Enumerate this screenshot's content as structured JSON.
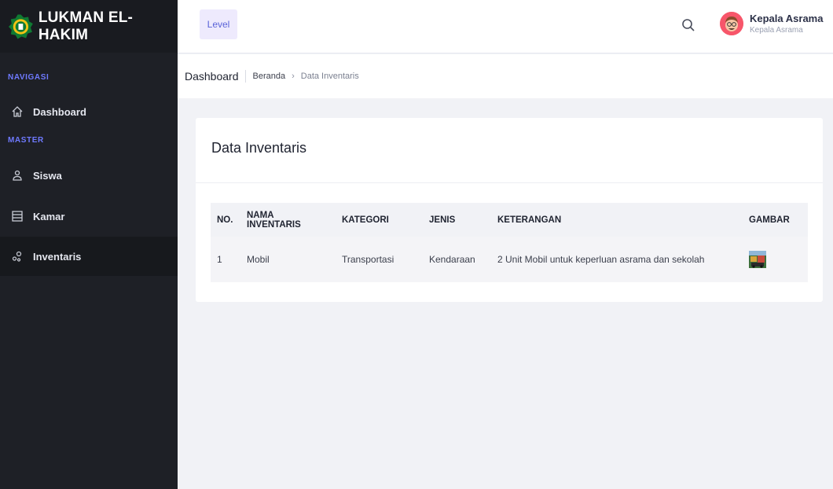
{
  "app": {
    "brand": "LUKMAN EL-HAKIM",
    "logo_icon": "ministry-logo-icon"
  },
  "sidebar": {
    "sections": [
      {
        "label": "NAVIGASI"
      },
      {
        "label": "MASTER"
      }
    ],
    "items": [
      {
        "label": "Dashboard",
        "icon": "home-icon",
        "active": false
      },
      {
        "label": "Siswa",
        "icon": "user-icon",
        "active": false
      },
      {
        "label": "Kamar",
        "icon": "list-box-icon",
        "active": false
      },
      {
        "label": "Inventaris",
        "icon": "nodes-icon",
        "active": true
      }
    ]
  },
  "topbar": {
    "level_label": "Level",
    "search_icon": "search-icon",
    "user_name": "Kepala Asrama",
    "user_role": "Kepala Asrama"
  },
  "breadcrumb": {
    "title": "Dashboard",
    "home": "Beranda",
    "separator": "›",
    "current": "Data Inventaris"
  },
  "card": {
    "title": "Data Inventaris"
  },
  "table": {
    "headers": [
      "NO.",
      "NAMA INVENTARIS",
      "KATEGORI",
      "JENIS",
      "KETERANGAN",
      "GAMBAR"
    ],
    "rows": [
      [
        "1",
        "Mobil",
        "Transportasi",
        "Kendaraan",
        "2 Unit Mobil untuk keperluan asrama dan sekolah"
      ]
    ]
  },
  "colors": {
    "sidebar_bg": "#1e2026",
    "accent": "#6f7aff",
    "level_bg": "#eeeafd",
    "avatar_bg": "#f7566a"
  }
}
